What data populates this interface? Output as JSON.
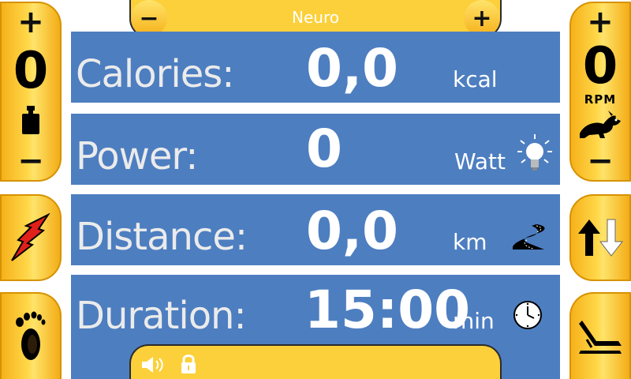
{
  "top_bar": {
    "program_name": "Neuro",
    "minus_label": "−",
    "plus_label": "+"
  },
  "left_stepper": {
    "plus_label": "+",
    "minus_label": "−",
    "value": "0"
  },
  "right_stepper": {
    "plus_label": "+",
    "minus_label": "−",
    "value": "0",
    "unit": "RPM"
  },
  "metrics": {
    "calories": {
      "label": "Calories:",
      "value": "0,0",
      "unit": "kcal"
    },
    "power": {
      "label": "Power:",
      "value": "0",
      "unit": "Watt"
    },
    "distance": {
      "label": "Distance:",
      "value": "0,0",
      "unit": "km"
    },
    "duration": {
      "label": "Duration:",
      "value": "15:00",
      "unit": "min"
    }
  },
  "icons": {
    "weight": "weight-icon",
    "rabbit": "rabbit-icon",
    "lightning": "lightning-icon",
    "arrows": "up-down-arrows-icon",
    "foot": "foot-icon",
    "seat": "seat-icon",
    "bulb": "light-bulb-icon",
    "road": "road-icon",
    "clock": "clock-icon",
    "speaker": "speaker-icon",
    "lock": "lock-icon"
  },
  "colors": {
    "panel": "#4d7ec0",
    "accent": "#fcd03a",
    "button": "#f6b11a"
  }
}
